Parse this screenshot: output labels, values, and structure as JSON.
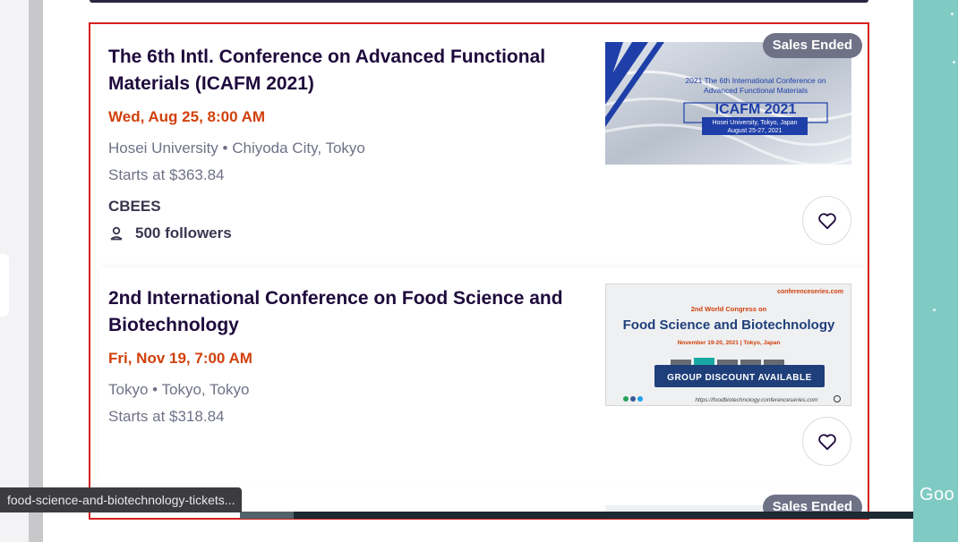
{
  "status_url": "food-science-and-biotechnology-tickets...",
  "map_label": "Goo",
  "events": [
    {
      "title": "The 6th Intl. Conference on Advanced Functional Materials (ICAFM 2021)",
      "date": "Wed, Aug 25, 8:00 AM",
      "location": "Hosei University • Chiyoda City, Tokyo",
      "price": "Starts at $363.84",
      "organizer": "CBEES",
      "followers": "500 followers",
      "badge": "Sales Ended",
      "thumb": {
        "line1": "2021 The 6th International Conference on",
        "line2": "Advanced Functional Materials",
        "acronym": "ICAFM 2021",
        "venue": "Hosei University, Tokyo, Japan",
        "dates": "August 25-27, 2021"
      }
    },
    {
      "title": "2nd International Conference on Food Science and Biotechnology",
      "date": "Fri, Nov 19, 7:00 AM",
      "location": "Tokyo • Tokyo, Tokyo",
      "price": "Starts at $318.84",
      "thumb": {
        "brand": "conferenceseries.com",
        "subtitle": "2nd World Congress on",
        "headline": "Food Science and Biotechnology",
        "dates": "November 19-20, 2021 | Tokyo, Japan",
        "cta": "GROUP DISCOUNT AVAILABLE",
        "url": "https://foodbiotechnology.conferenceseries.com"
      }
    },
    {
      "badge": "Sales Ended"
    }
  ],
  "colors": {
    "title": "#1e0a3c",
    "date": "#d1410c",
    "muted": "#6f7287",
    "highlight_border": "#d81f1f",
    "map": "#7fcbc4"
  }
}
